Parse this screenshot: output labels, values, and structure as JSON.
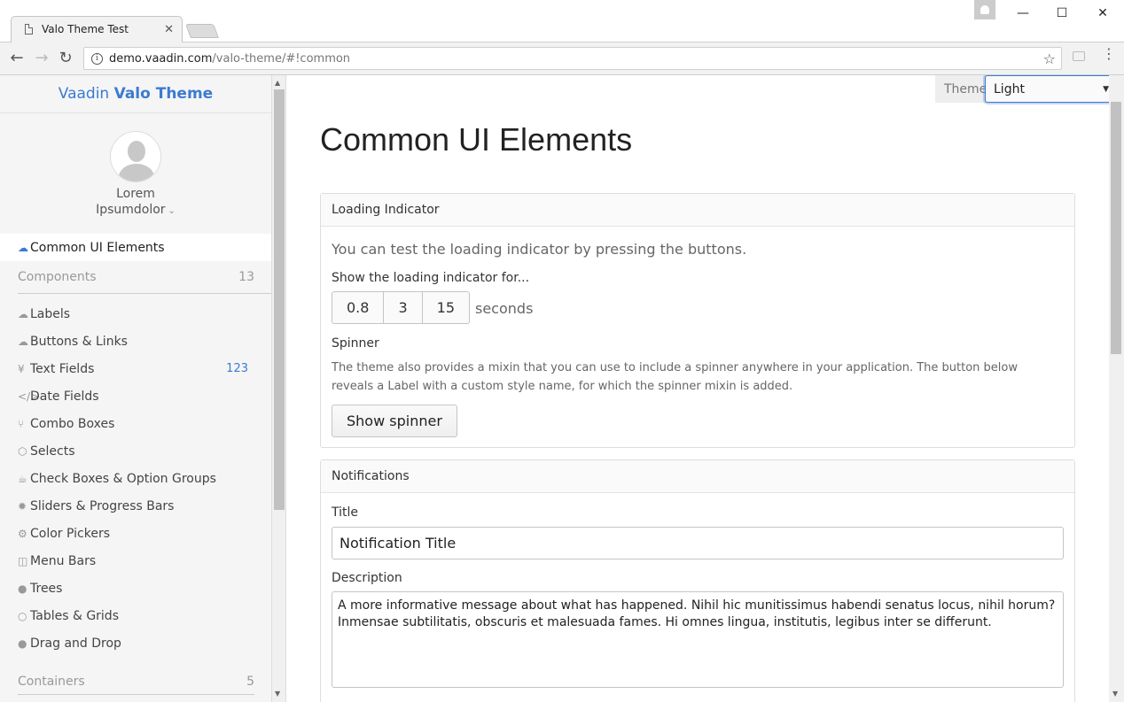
{
  "browser": {
    "tab_title": "Valo Theme Test",
    "tab_close": "✕",
    "url_host": "demo.vaadin.com",
    "url_path": "/valo-theme/#!common",
    "window_buttons": {
      "minimize": "—",
      "maximize": "☐",
      "close": "✕"
    },
    "nav": {
      "back": "←",
      "forward": "→",
      "reload": "↻"
    },
    "icons": {
      "star": "☆",
      "info": "i",
      "menu": "⋮"
    }
  },
  "sidebar": {
    "brand_prefix": "Vaadin",
    "brand_name": "Valo Theme",
    "user_first": "Lorem",
    "user_last": "Ipsumdolor",
    "user_chevron": "⌄",
    "active_item": {
      "label": "Common UI Elements",
      "icon": "☁"
    },
    "components_caption": "Components",
    "components_count": "13",
    "items": [
      {
        "label": "Labels",
        "icon": "☁",
        "badge": ""
      },
      {
        "label": "Buttons & Links",
        "icon": "☁",
        "badge": ""
      },
      {
        "label": "Text Fields",
        "icon": "¥",
        "badge": "123"
      },
      {
        "label": "Date Fields",
        "icon": "</>",
        "badge": ""
      },
      {
        "label": "Combo Boxes",
        "icon": "⑂",
        "badge": ""
      },
      {
        "label": "Selects",
        "icon": "⬡",
        "badge": ""
      },
      {
        "label": "Check Boxes & Option Groups",
        "icon": "☕",
        "badge": ""
      },
      {
        "label": "Sliders & Progress Bars",
        "icon": "✹",
        "badge": ""
      },
      {
        "label": "Color Pickers",
        "icon": "⚙",
        "badge": ""
      },
      {
        "label": "Menu Bars",
        "icon": "◫",
        "badge": ""
      },
      {
        "label": "Trees",
        "icon": "●",
        "badge": ""
      },
      {
        "label": "Tables & Grids",
        "icon": "○",
        "badge": ""
      },
      {
        "label": "Drag and Drop",
        "icon": "●",
        "badge": ""
      }
    ],
    "containers_caption": "Containers",
    "containers_count": "5"
  },
  "main": {
    "theme_label": "Theme:",
    "theme_value": "Light",
    "theme_caret": "▼",
    "page_title": "Common UI Elements",
    "loading": {
      "caption": "Loading Indicator",
      "lead": "You can test the loading indicator by pressing the buttons.",
      "show_caption": "Show the loading indicator for...",
      "buttons": [
        "0.8",
        "3",
        "15"
      ],
      "seconds": "seconds",
      "spinner_caption": "Spinner",
      "spinner_desc": "The theme also provides a mixin that you can use to include a spinner anywhere in your application. The button below reveals a Label with a custom style name, for which the spinner mixin is added.",
      "spinner_button": "Show spinner"
    },
    "notifications": {
      "caption": "Notifications",
      "title_label": "Title",
      "title_value": "Notification Title",
      "desc_label": "Description",
      "desc_value": "A more informative message about what has happened. Nihil hic munitissimus habendi senatus locus, nihil horum? Inmensae subtilitatis, obscuris et malesuada fames. Hi omnes lingua, institutis, legibus inter se differunt."
    }
  },
  "colors": {
    "accent": "#3b7bd1",
    "sidebar_bg": "#f5f5f5",
    "muted": "#999999"
  }
}
